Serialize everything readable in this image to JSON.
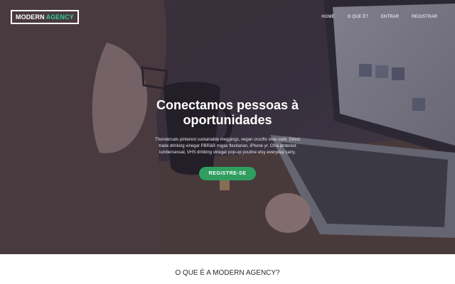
{
  "nav": {
    "logo_part1": "MODERN",
    "logo_part2": "AGENCY",
    "links": [
      "HOME",
      "O QUE É?",
      "ENTRAR",
      "REGISTRAR"
    ]
  },
  "hero": {
    "title": "Conectamos pessoas à oportunidades",
    "text": "Thundercats pinterest sustainable meggings, vegan crucifix slow-carb. Direct trade drinking vinegar PBR&B migas flexitarian, iPhone yr. Chia pinterest lumbersexual, VHS drinking vinegar pop-up poutine etsy everyday carry.",
    "cta_label": "REGISTRE-SE"
  },
  "section": {
    "title": "O QUE É A MODERN AGENCY?"
  },
  "colors": {
    "accent": "#33cc9a",
    "cta": "#2f9e5f"
  }
}
